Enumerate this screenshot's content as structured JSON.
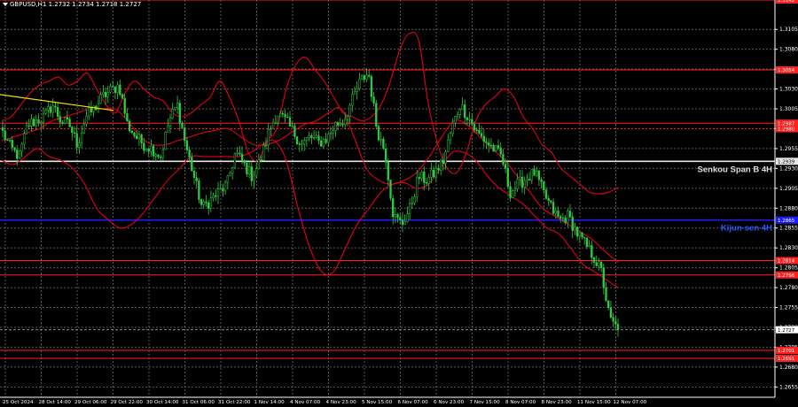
{
  "header": {
    "symbol_info": "GBPUSD,H1  1.2732 1.2734 1.2718 1.2727"
  },
  "colors": {
    "background": "#000000",
    "grid": "#5a5a5a",
    "bull_candle": "#2ecc40",
    "bear_candle": "#2ecc40",
    "bollinger": "#e3001b",
    "level_red": "#ff2020",
    "senkou": "#e6e6e6",
    "kijun": "#1c1cff",
    "trend": "#f0e000",
    "axis_text": "#ffffff",
    "last_price_tag": "#ffffff"
  },
  "chart_data": {
    "type": "candlestick",
    "symbol": "GBPUSD",
    "timeframe": "H1",
    "ohlc_last": {
      "open": 1.2732,
      "high": 1.2734,
      "low": 1.2718,
      "close": 1.2727
    },
    "ylim": [
      1.2642,
      1.3142
    ],
    "y_ticks": [
      "1.3105",
      "1.3080",
      "1.3055",
      "1.3030",
      "1.3005",
      "1.2980",
      "1.2955",
      "1.2930",
      "1.2905",
      "1.2880",
      "1.2855",
      "1.2830",
      "1.2805",
      "1.2780",
      "1.2755",
      "1.2730",
      "1.2705",
      "1.2680",
      "1.2655"
    ],
    "x_ticks": [
      "25 Oct 2024",
      "28 Oct 14:00",
      "29 Oct 06:00",
      "29 Oct 22:00",
      "30 Oct 14:00",
      "31 Oct 06:00",
      "31 Oct 22:00",
      "1 Nov 14:00",
      "4 Nov 07:00",
      "4 Nov 23:00",
      "5 Nov 15:00",
      "6 Nov 07:00",
      "6 Nov 23:00",
      "7 Nov 15:00",
      "8 Nov 07:00",
      "8 Nov 23:00",
      "11 Nov 15:00",
      "12 Nov 07:00"
    ],
    "price_path": [
      1.2975,
      1.2955,
      1.2945,
      1.2985,
      1.299,
      1.2995,
      1.301,
      1.299,
      1.2985,
      1.296,
      1.2995,
      1.3005,
      1.302,
      1.3028,
      1.3035,
      1.2985,
      1.297,
      1.296,
      1.2955,
      1.2945,
      1.299,
      1.301,
      1.296,
      1.292,
      1.288,
      1.289,
      1.29,
      1.291,
      1.295,
      1.2935,
      1.292,
      1.294,
      1.2975,
      1.3,
      1.299,
      1.2975,
      1.296,
      1.297,
      1.2962,
      1.2968,
      1.2985,
      1.299,
      1.3015,
      1.304,
      1.305,
      1.298,
      1.295,
      1.287,
      1.286,
      1.288,
      1.292,
      1.2915,
      1.2925,
      1.294,
      1.298,
      1.301,
      1.2995,
      1.2975,
      1.2965,
      1.2955,
      1.2945,
      1.29,
      1.291,
      1.2918,
      1.2925,
      1.29,
      1.288,
      1.2865,
      1.287,
      1.285,
      1.2835,
      1.282,
      1.28,
      1.274,
      1.2727
    ],
    "bollinger_upper": [
      1.299,
      1.2995,
      1.301,
      1.3025,
      1.3035,
      1.304,
      1.3045,
      1.3035,
      1.304,
      1.305,
      1.303,
      1.301,
      1.3,
      1.3025,
      1.304,
      1.303,
      1.302,
      1.3015,
      1.3,
      1.2995,
      1.3,
      1.301,
      1.302,
      1.304,
      1.302,
      1.299,
      1.295,
      1.294,
      1.2965,
      1.298,
      1.303,
      1.306,
      1.307,
      1.3055,
      1.304,
      1.302,
      1.3,
      1.2995,
      1.299,
      1.2995,
      1.301,
      1.304,
      1.308,
      1.31,
      1.309,
      1.301,
      1.296,
      1.293,
      1.2925,
      1.295,
      1.299,
      1.301,
      1.302,
      1.303,
      1.302,
      1.2995,
      1.298,
      1.296,
      1.295,
      1.293,
      1.292,
      1.291,
      1.29,
      1.2898,
      1.29,
      1.2906
    ],
    "bollinger_middle": [
      1.2965,
      1.297,
      1.2975,
      1.298,
      1.299,
      1.2995,
      1.3,
      1.3005,
      1.3005,
      1.3005,
      1.299,
      1.297,
      1.296,
      1.296,
      1.2965,
      1.297,
      1.2975,
      1.2978,
      1.298,
      1.297,
      1.296,
      1.296,
      1.2965,
      1.2975,
      1.2985,
      1.299,
      1.3,
      1.3005,
      1.297,
      1.293,
      1.2915,
      1.291,
      1.2915,
      1.2925,
      1.2945,
      1.297,
      1.299,
      1.2985,
      1.297,
      1.2955,
      1.294,
      1.292,
      1.29,
      1.288,
      1.287,
      1.286,
      1.285,
      1.284,
      1.2825,
      1.2812
    ],
    "bollinger_lower": [
      1.294,
      1.2935,
      1.2945,
      1.2955,
      1.2945,
      1.294,
      1.293,
      1.291,
      1.288,
      1.2865,
      1.2855,
      1.286,
      1.2875,
      1.2895,
      1.2915,
      1.293,
      1.2945,
      1.2945,
      1.2945,
      1.2945,
      1.2945,
      1.295,
      1.296,
      1.2965,
      1.294,
      1.288,
      1.283,
      1.28,
      1.28,
      1.283,
      1.286,
      1.288,
      1.29,
      1.291,
      1.2912,
      1.2905,
      1.291,
      1.293,
      1.295,
      1.295,
      1.294,
      1.292,
      1.2905,
      1.2895,
      1.2885,
      1.287,
      1.2855,
      1.2848,
      1.283,
      1.281,
      1.28,
      1.279,
      1.278
    ],
    "levels": [
      {
        "name": "",
        "value": 1.3142,
        "tag": "1.3142",
        "color": "#ff2020",
        "style": "solid"
      },
      {
        "name": "",
        "value": 1.3054,
        "tag": "1.3054",
        "color": "#ff2020",
        "style": "solid"
      },
      {
        "name": "",
        "value": 1.2987,
        "tag": "1.2987",
        "color": "#ff2020",
        "style": "solid"
      },
      {
        "name": "",
        "value": 1.298,
        "tag": "1.2980",
        "color": "#ff2020",
        "style": "dotted"
      },
      {
        "name": "Senkou Span B 4H",
        "value": 1.2939,
        "tag": "1.2939",
        "color": "#e6e6e6",
        "style": "solid"
      },
      {
        "name": "Kijun-sen 4H",
        "value": 1.2865,
        "tag": "1.2865",
        "color": "#1c1cff",
        "style": "solid"
      },
      {
        "name": "",
        "value": 1.2814,
        "tag": "1.2814",
        "color": "#ff2020",
        "style": "solid"
      },
      {
        "name": "",
        "value": 1.2796,
        "tag": "1.2796",
        "color": "#ff2020",
        "style": "solid"
      },
      {
        "name": "",
        "value": 1.2701,
        "tag": "1.2701",
        "color": "#ff2020",
        "style": "solid"
      },
      {
        "name": "",
        "value": 1.2691,
        "tag": "1.2691",
        "color": "#ff2020",
        "style": "solid"
      }
    ],
    "current_price": {
      "value": 1.2727,
      "tag": "1.2727"
    },
    "trend_line": {
      "from": 1.3023,
      "to": 1.3003
    }
  }
}
